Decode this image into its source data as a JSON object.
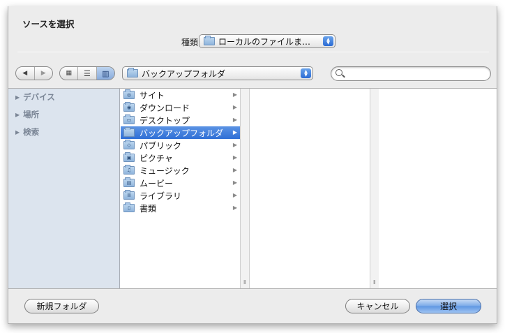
{
  "dialog": {
    "title": "ソースを選択"
  },
  "kind": {
    "label": "種類:",
    "value": "ローカルのファイルま…"
  },
  "toolbar": {
    "nav_back_icon": "back-arrow",
    "nav_forward_icon": "forward-arrow",
    "views": [
      "icon-view",
      "list-view",
      "column-view"
    ],
    "location": "バックアップフォルダ",
    "search": {
      "value": "",
      "placeholder": ""
    }
  },
  "sidebar": {
    "items": [
      {
        "label": "デバイス"
      },
      {
        "label": "場所"
      },
      {
        "label": "検索"
      }
    ]
  },
  "columns": {
    "col1": [
      {
        "label": "サイト",
        "icon": "sites-folder-icon",
        "selected": false
      },
      {
        "label": "ダウンロード",
        "icon": "downloads-folder-icon",
        "selected": false
      },
      {
        "label": "デスクトップ",
        "icon": "desktop-folder-icon",
        "selected": false
      },
      {
        "label": "バックアップフォルダ",
        "icon": "folder-icon",
        "selected": true
      },
      {
        "label": "パブリック",
        "icon": "public-folder-icon",
        "selected": false
      },
      {
        "label": "ピクチャ",
        "icon": "pictures-folder-icon",
        "selected": false
      },
      {
        "label": "ミュージック",
        "icon": "music-folder-icon",
        "selected": false
      },
      {
        "label": "ムービー",
        "icon": "movies-folder-icon",
        "selected": false
      },
      {
        "label": "ライブラリ",
        "icon": "library-folder-icon",
        "selected": false
      },
      {
        "label": "書類",
        "icon": "documents-folder-icon",
        "selected": false
      }
    ]
  },
  "footer": {
    "new_folder": "新規フォルダ",
    "cancel": "キャンセル",
    "choose": "選択"
  }
}
